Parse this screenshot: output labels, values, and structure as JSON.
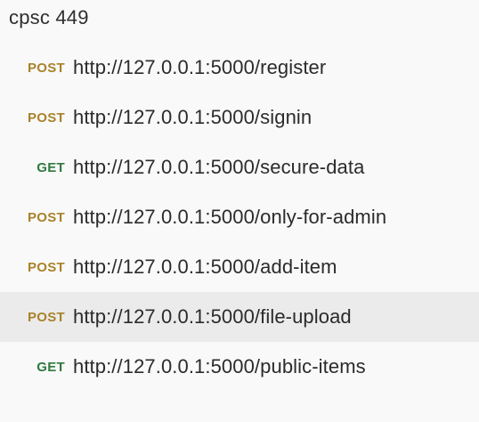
{
  "collection": {
    "title": "cpsc 449"
  },
  "requests": [
    {
      "method": "POST",
      "url": "http://127.0.0.1:5000/register"
    },
    {
      "method": "POST",
      "url": "http://127.0.0.1:5000/signin"
    },
    {
      "method": "GET",
      "url": "http://127.0.0.1:5000/secure-data"
    },
    {
      "method": "POST",
      "url": "http://127.0.0.1:5000/only-for-admin"
    },
    {
      "method": "POST",
      "url": "http://127.0.0.1:5000/add-item"
    },
    {
      "method": "POST",
      "url": "http://127.0.0.1:5000/file-upload",
      "selected": true
    },
    {
      "method": "GET",
      "url": "http://127.0.0.1:5000/public-items"
    }
  ],
  "colors": {
    "post": "#a9822a",
    "get": "#2f7a3f",
    "selected_background": "#ebebeb",
    "panel_background": "#f9f9f9"
  }
}
